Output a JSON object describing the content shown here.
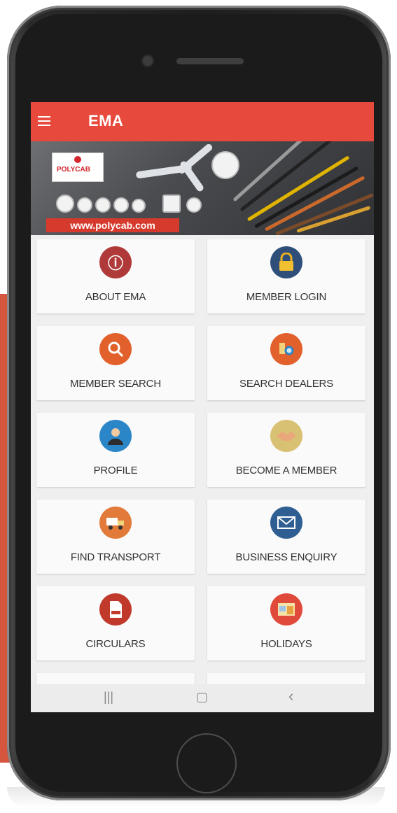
{
  "app": {
    "title": "EMA"
  },
  "banner": {
    "logo_text": "POLYCAB",
    "url": "www.polycab.com"
  },
  "tiles": [
    {
      "label": "ABOUT EMA",
      "icon": "info-icon",
      "color": "#b03a3a",
      "glyph": "ⓘ"
    },
    {
      "label": "MEMBER LOGIN",
      "icon": "lock-icon",
      "color": "#d8a82a",
      "glyph": "🔒"
    },
    {
      "label": "MEMBER SEARCH",
      "icon": "magnify-user-icon",
      "color": "#e1602b",
      "glyph": "🔍"
    },
    {
      "label": "SEARCH DEALERS",
      "icon": "dealer-search-icon",
      "color": "#e1602b",
      "glyph": "🔎"
    },
    {
      "label": "PROFILE",
      "icon": "person-icon",
      "color": "#2b86c8",
      "glyph": "👤"
    },
    {
      "label": "BECOME A MEMBER",
      "icon": "handshake-icon",
      "color": "#d9c173",
      "glyph": "🤝"
    },
    {
      "label": "FIND TRANSPORT",
      "icon": "truck-icon",
      "color": "#e27a3a",
      "glyph": "🚚"
    },
    {
      "label": "BUSINESS ENQUIRY",
      "icon": "envelope-icon",
      "color": "#2f5f92",
      "glyph": "✉"
    },
    {
      "label": "CIRCULARS",
      "icon": "document-icon",
      "color": "#c0392b",
      "glyph": "📄"
    },
    {
      "label": "HOLIDAYS",
      "icon": "calendar-icon",
      "color": "#e04a3a",
      "glyph": "📅"
    }
  ],
  "nav": {
    "recent": "|||",
    "home": "▢",
    "back": "‹"
  }
}
